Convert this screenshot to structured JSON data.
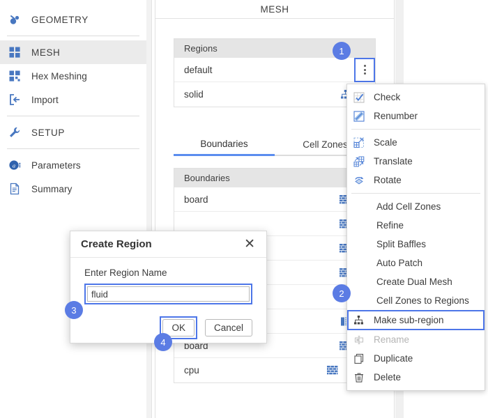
{
  "sidebar": {
    "groups": [
      {
        "items": [
          {
            "label": "GEOMETRY",
            "icon": "geometry-icon",
            "selected": false
          }
        ]
      },
      {
        "items": [
          {
            "label": "MESH",
            "icon": "mesh-grid-icon",
            "selected": true
          },
          {
            "label": "Hex Meshing",
            "icon": "hex-mesh-icon",
            "selected": false
          },
          {
            "label": "Import",
            "icon": "import-icon",
            "selected": false
          }
        ]
      },
      {
        "items": [
          {
            "label": "SETUP",
            "icon": "wrench-icon",
            "selected": false
          }
        ]
      },
      {
        "items": [
          {
            "label": "Parameters",
            "icon": "parameters-icon",
            "selected": false
          },
          {
            "label": "Summary",
            "icon": "document-icon",
            "selected": false
          }
        ]
      }
    ]
  },
  "main": {
    "title": "MESH",
    "regions": {
      "header": "Regions",
      "rows": [
        {
          "name": "default",
          "icon": "",
          "has_chevron": false,
          "has_kebab": true
        },
        {
          "name": "solid",
          "icon": "sub-region-icon",
          "has_chevron": true,
          "has_kebab": false
        }
      ]
    },
    "tabs": [
      {
        "label": "Boundaries",
        "active": true
      },
      {
        "label": "Cell Zones",
        "active": false
      }
    ],
    "boundaries": {
      "header": "Boundaries",
      "rows": [
        {
          "name": "board",
          "icon": "wall-icon",
          "has_chevron": true,
          "has_kebab": false
        },
        {
          "name": "",
          "icon": "wall-icon",
          "has_chevron": true,
          "has_kebab": false
        },
        {
          "name": "",
          "icon": "wall-icon",
          "has_chevron": true,
          "has_kebab": false
        },
        {
          "name": "",
          "icon": "wall-icon",
          "has_chevron": true,
          "has_kebab": false
        },
        {
          "name": "",
          "icon": "baffle-icon",
          "has_chevron": true,
          "has_kebab": false
        },
        {
          "name": "",
          "icon": "baffle-icon",
          "has_chevron": true,
          "has_kebab": false
        },
        {
          "name": "board",
          "icon": "wall-icon",
          "has_chevron": true,
          "has_kebab": false
        },
        {
          "name": "cpu",
          "icon": "wall-icon",
          "has_chevron": true,
          "has_kebab": true
        }
      ]
    }
  },
  "context_menu": {
    "items": [
      {
        "label": "Check",
        "icon": "check-grid-icon",
        "state": "normal",
        "sep_after": false
      },
      {
        "label": "Renumber",
        "icon": "renumber-icon",
        "state": "normal",
        "sep_after": true
      },
      {
        "label": "Scale",
        "icon": "scale-icon",
        "state": "normal",
        "sep_after": false
      },
      {
        "label": "Translate",
        "icon": "translate-icon",
        "state": "normal",
        "sep_after": false
      },
      {
        "label": "Rotate",
        "icon": "rotate-icon",
        "state": "normal",
        "sep_after": true
      },
      {
        "label": "Add Cell Zones",
        "icon": "",
        "state": "normal",
        "sep_after": false
      },
      {
        "label": "Refine",
        "icon": "",
        "state": "normal",
        "sep_after": false
      },
      {
        "label": "Split Baffles",
        "icon": "",
        "state": "normal",
        "sep_after": false
      },
      {
        "label": "Auto Patch",
        "icon": "",
        "state": "normal",
        "sep_after": false
      },
      {
        "label": "Create Dual Mesh",
        "icon": "",
        "state": "normal",
        "sep_after": false
      },
      {
        "label": "Cell Zones to Regions",
        "icon": "",
        "state": "normal",
        "sep_after": false
      },
      {
        "label": "Make sub-region",
        "icon": "sub-region-icon",
        "state": "highlight",
        "sep_after": false
      },
      {
        "label": "Rename",
        "icon": "rename-icon",
        "state": "disabled",
        "sep_after": false
      },
      {
        "label": "Duplicate",
        "icon": "duplicate-icon",
        "state": "normal",
        "sep_after": false
      },
      {
        "label": "Delete",
        "icon": "trash-icon",
        "state": "normal",
        "sep_after": false
      }
    ]
  },
  "dialog": {
    "title": "Create Region",
    "close_icon": "close-icon",
    "field_label": "Enter Region Name",
    "field_value": "fluid",
    "field_placeholder": "",
    "ok_label": "OK",
    "cancel_label": "Cancel"
  },
  "badges": [
    {
      "number": "1"
    },
    {
      "number": "2"
    },
    {
      "number": "3"
    },
    {
      "number": "4"
    }
  ],
  "colors": {
    "accent_blue": "#4d76e8",
    "badge_blue": "#5b7ce4",
    "tab_underline": "#5b8def",
    "icon_blue": "#4877c0",
    "header_gray": "#e5e5e5"
  }
}
